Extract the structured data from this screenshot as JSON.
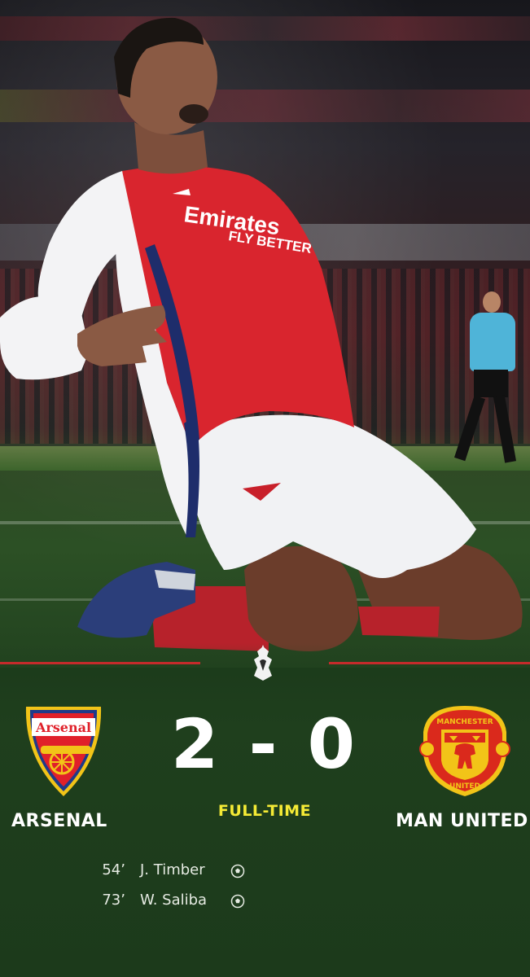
{
  "photo": {
    "shirt_sponsor": "Emirates",
    "shirt_sponsor_tagline": "FLY BETTER"
  },
  "match": {
    "home_team": "ARSENAL",
    "away_team": "MAN UNITED",
    "home_crest_text": "Arsenal",
    "away_crest_text": "MANCHESTER UNITED",
    "score_display": "2 - 0",
    "status": "FULL-TIME",
    "scorers": [
      {
        "minute": "54’",
        "name": "J. Timber"
      },
      {
        "minute": "73’",
        "name": "W. Saliba"
      }
    ]
  },
  "colors": {
    "divider": "#c42b2b",
    "status_yellow": "#f4ea35",
    "arsenal_red": "#e0202a",
    "united_red": "#da291c",
    "united_gold": "#f2c418"
  },
  "icons": [
    "premier-league-lion-icon",
    "football-icon"
  ]
}
